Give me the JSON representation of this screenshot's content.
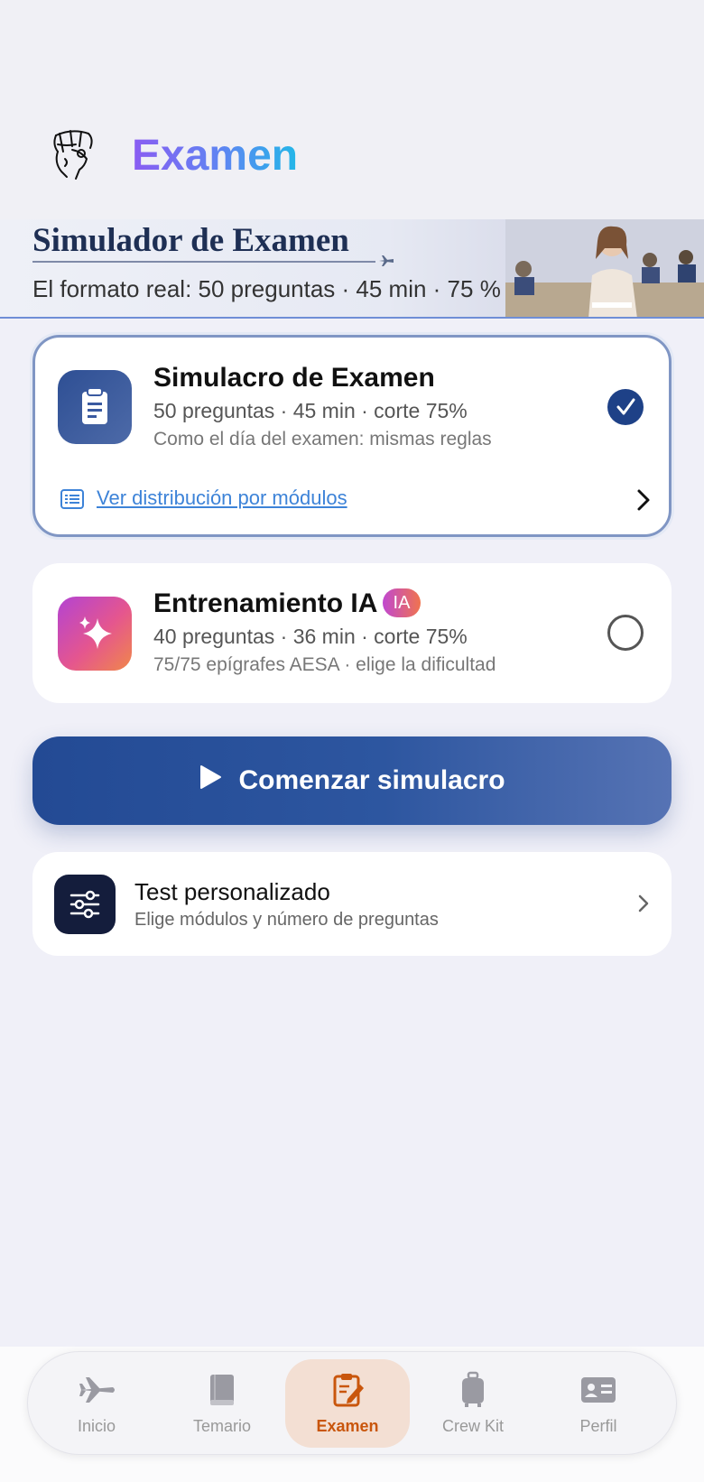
{
  "header": {
    "title": "Examen"
  },
  "banner": {
    "title": "Simulador de Examen",
    "subtitle": "El formato real: 50 preguntas · 45 min · 75 %"
  },
  "options": [
    {
      "title": "Simulacro de Examen",
      "meta": "50 preguntas · 45 min · corte 75%",
      "description": "Como el día del examen: mismas reglas",
      "link": "Ver distribución por módulos",
      "selected": true
    },
    {
      "title": "Entrenamiento IA",
      "badge": "IA",
      "meta": "40 preguntas · 36 min · corte 75%",
      "description": "75/75 epígrafes AESA · elige la dificultad",
      "selected": false
    }
  ],
  "start_button": {
    "label": "Comenzar simulacro"
  },
  "custom_test": {
    "title": "Test personalizado",
    "subtitle": "Elige módulos y número de preguntas"
  },
  "nav": {
    "items": [
      {
        "label": "Inicio",
        "icon": "plane-icon"
      },
      {
        "label": "Temario",
        "icon": "book-icon"
      },
      {
        "label": "Examen",
        "icon": "exam-icon",
        "active": true
      },
      {
        "label": "Crew Kit",
        "icon": "luggage-icon"
      },
      {
        "label": "Perfil",
        "icon": "id-card-icon"
      }
    ]
  },
  "colors": {
    "primary": "#1e4187",
    "accent_active": "#c9560c",
    "link": "#3d83d8"
  }
}
